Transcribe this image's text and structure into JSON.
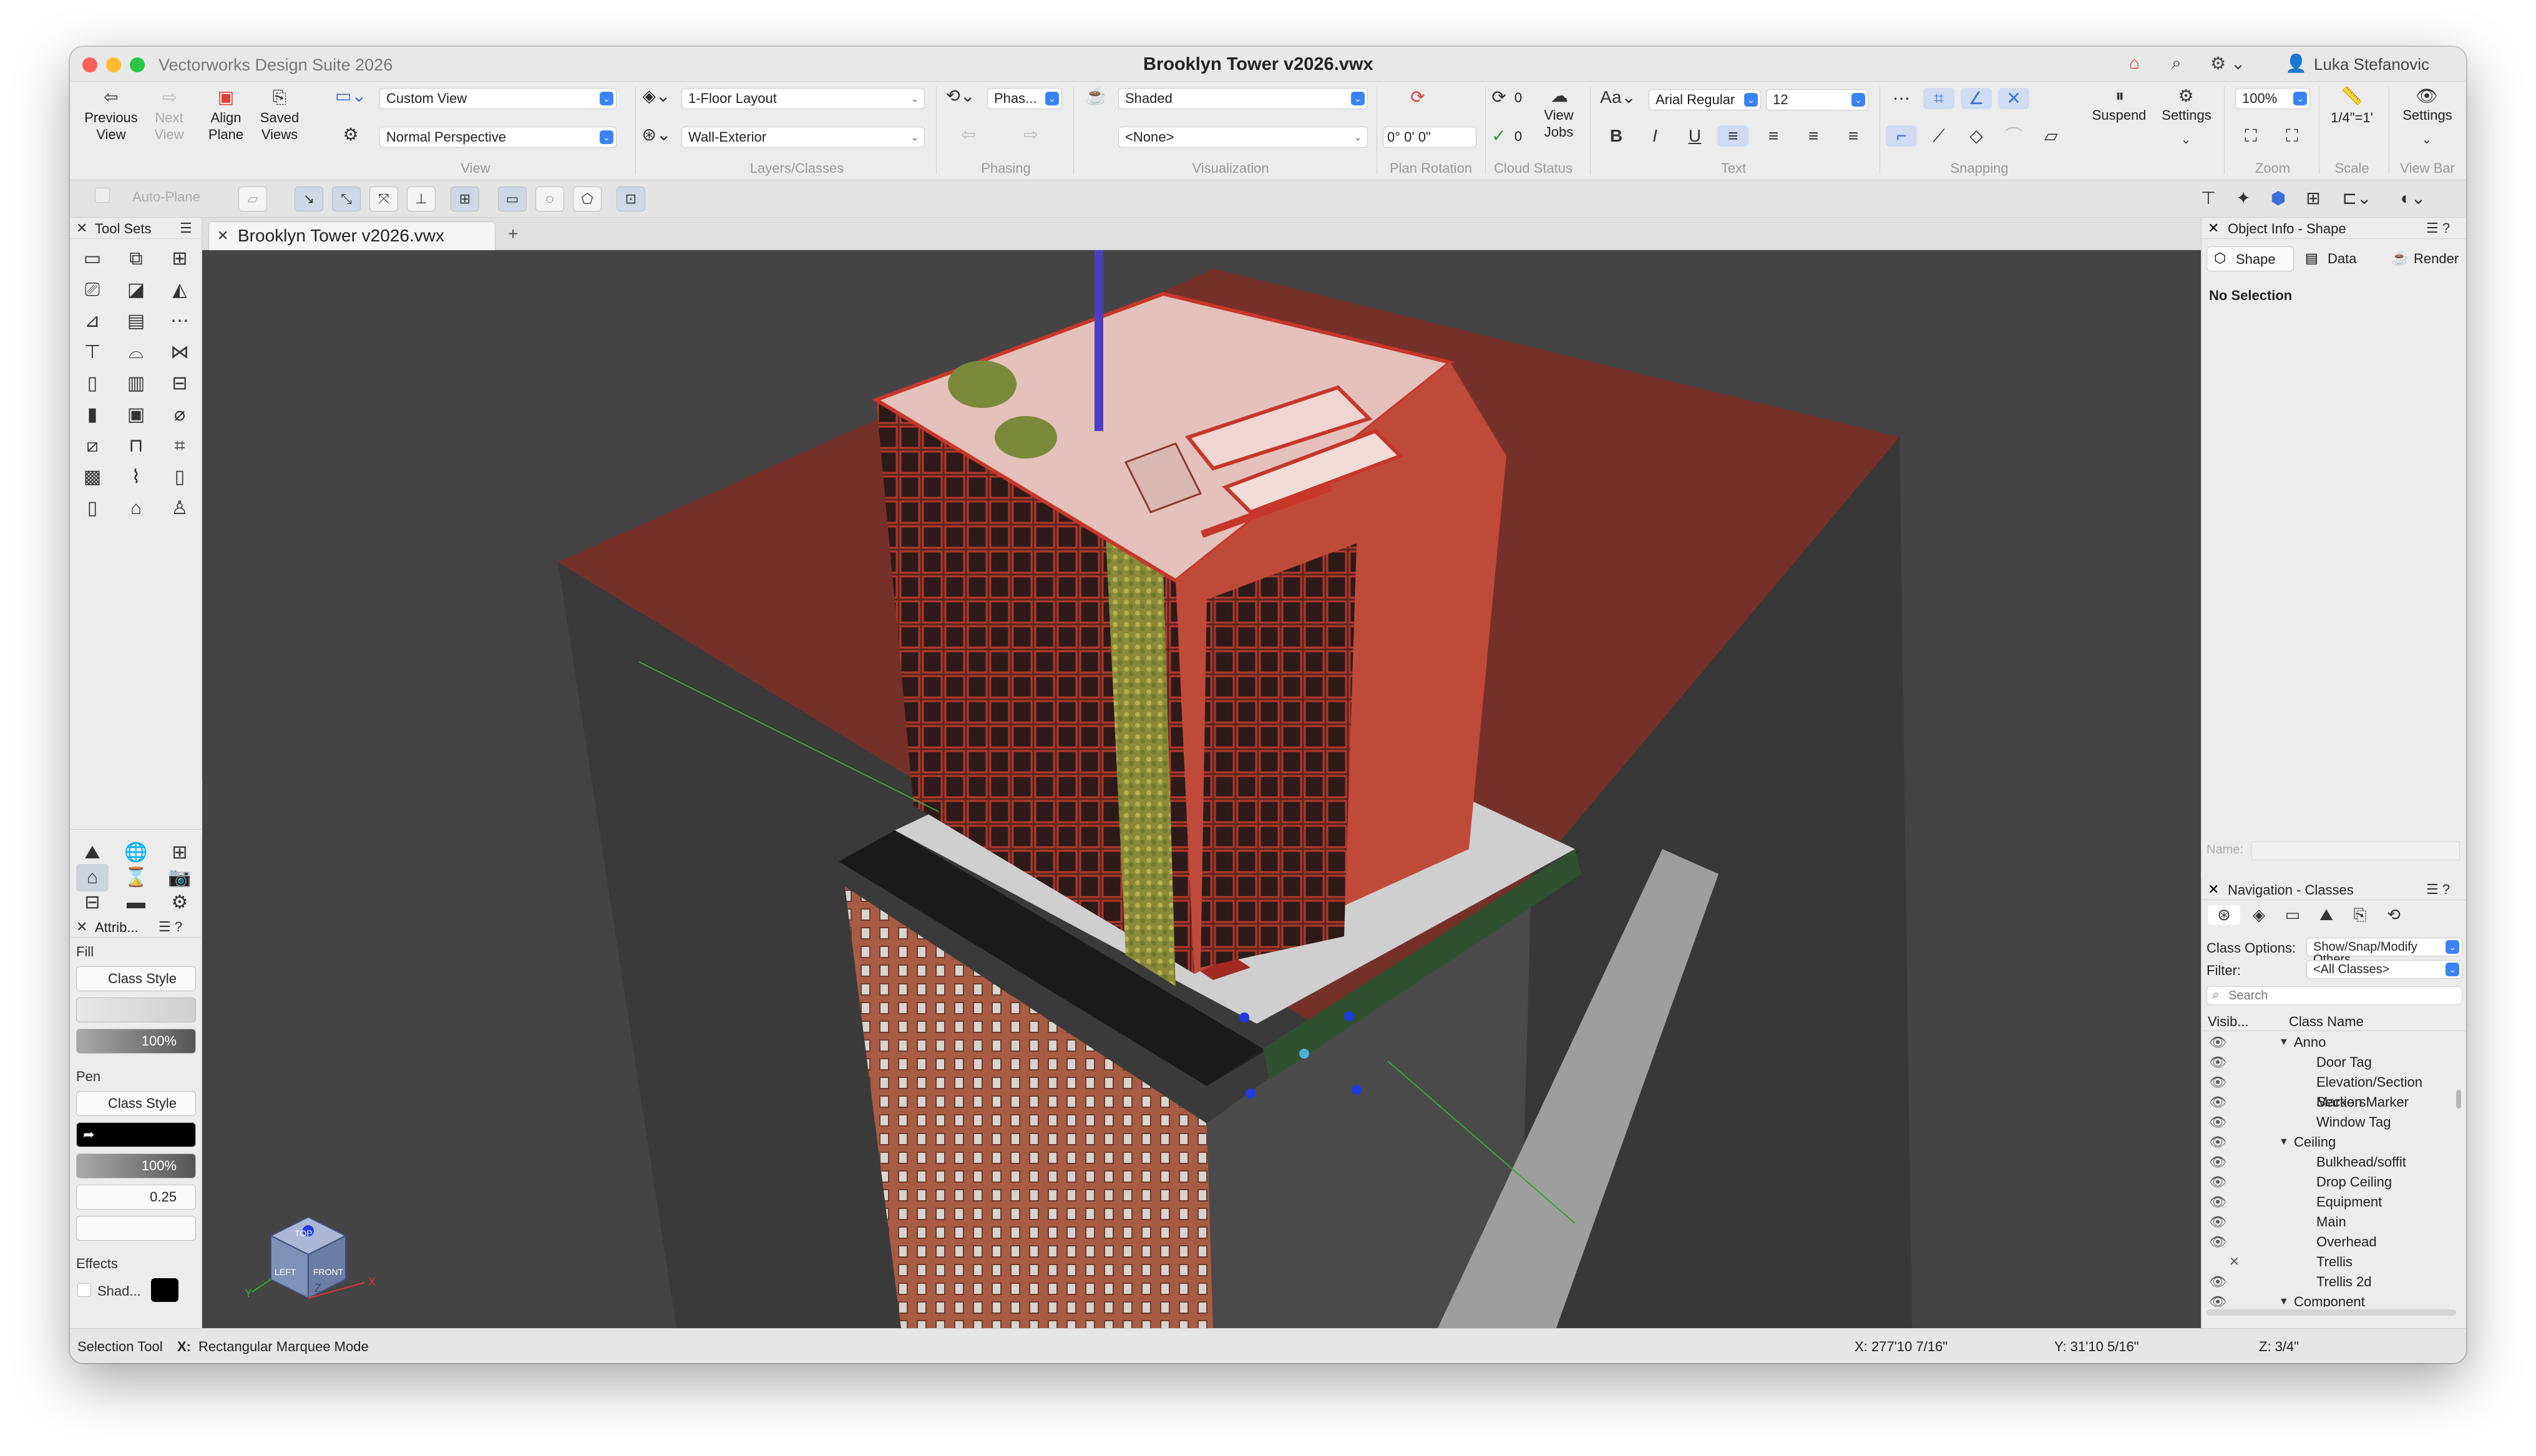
{
  "window": {
    "app_title": "Vectorworks Design Suite 2026",
    "doc_title": "Brooklyn Tower v2026.vwx",
    "user": "Luka Stefanovic"
  },
  "ribbon": {
    "previous_view": "Previous View",
    "next_view": "Next View",
    "align_plane": "Align Plane",
    "saved_views": "Saved Views",
    "view_dropdown": "Custom View",
    "projection_dropdown": "Normal Perspective",
    "view_group": "View",
    "layer_dropdown": "1-Floor Layout",
    "class_dropdown": "Wall-Exterior",
    "layers_group": "Layers/Classes",
    "phasing_dropdown": "Phas...",
    "phasing_group": "Phasing",
    "render_dropdown": "Shaded",
    "viz_dropdown": "<None>",
    "visualization_group": "Visualization",
    "plan_rotation_value": "0° 0' 0\"",
    "plan_rotation_group": "Plan Rotation",
    "cloud_count_a": "0",
    "cloud_count_b": "0",
    "cloud_status_group": "Cloud Status",
    "view_jobs": "View Jobs",
    "font_name": "Arial Regular",
    "font_size": "12",
    "text_group": "Text",
    "snapping_group": "Snapping",
    "suspend": "Suspend",
    "settings": "Settings",
    "zoom_value": "100%",
    "zoom_group": "Zoom",
    "scale_value": "1/4\"=1'",
    "scale_group": "Scale",
    "viewbar_settings": "Settings",
    "viewbar_group": "View Bar"
  },
  "row2": {
    "auto_plane": "Auto-Plane"
  },
  "toolsets": {
    "title": "Tool Sets"
  },
  "attributes": {
    "title": "Attrib...",
    "fill_label": "Fill",
    "fill_style": "Class Style",
    "fill_opacity": "100%",
    "pen_label": "Pen",
    "pen_style": "Class Style",
    "pen_opacity": "100%",
    "pen_weight": "0.25",
    "effects_label": "Effects",
    "shadow": "Shad..."
  },
  "document_tab": {
    "label": "Brooklyn Tower v2026.vwx"
  },
  "view_cube": {
    "face_top": "TOP",
    "face_left": "LEFT",
    "face_front": "FRONT",
    "axis_x": "X",
    "axis_y": "Y",
    "axis_z": "Z"
  },
  "object_info": {
    "title": "Object Info - Shape",
    "tab_shape": "Shape",
    "tab_data": "Data",
    "tab_render": "Render",
    "selection": "No Selection",
    "name_label": "Name:"
  },
  "navigation": {
    "title": "Navigation - Classes",
    "class_options_label": "Class Options:",
    "class_options_value": "Show/Snap/Modify Others",
    "filter_label": "Filter:",
    "filter_value": "<All Classes>",
    "search_placeholder": "Search",
    "col_visibility": "Visib...",
    "col_class_name": "Class Name",
    "rows": [
      {
        "name": "Anno",
        "level": 0,
        "expanded": true,
        "vis": "eye"
      },
      {
        "name": "Door Tag",
        "level": 1,
        "vis": "eye"
      },
      {
        "name": "Elevation/Section Markers",
        "level": 1,
        "vis": "eye"
      },
      {
        "name": "Section Marker",
        "level": 1,
        "vis": "eye"
      },
      {
        "name": "Window Tag",
        "level": 1,
        "vis": "eye"
      },
      {
        "name": "Ceiling",
        "level": 0,
        "expanded": true,
        "vis": "eye"
      },
      {
        "name": "Bulkhead/soffit",
        "level": 1,
        "vis": "eye"
      },
      {
        "name": "Drop Ceiling",
        "level": 1,
        "vis": "eye"
      },
      {
        "name": "Equipment",
        "level": 1,
        "vis": "eye"
      },
      {
        "name": "Main",
        "level": 1,
        "vis": "eye"
      },
      {
        "name": "Overhead",
        "level": 1,
        "vis": "eye"
      },
      {
        "name": "Trellis",
        "level": 1,
        "vis": "x"
      },
      {
        "name": "Trellis 2d",
        "level": 1,
        "vis": "eye"
      },
      {
        "name": "Component",
        "level": 0,
        "expanded": true,
        "vis": "eye"
      }
    ]
  },
  "status": {
    "tool": "Selection Tool",
    "mode_key": "X:",
    "mode": "Rectangular Marquee Mode",
    "x_coord": "X: 277'10 7/16\"",
    "y_coord": "Y: 31'10 5/16\"",
    "z_coord": "Z: 3/4\""
  },
  "colors": {
    "accent": "#3b82f6",
    "viewport_bg": "#444444",
    "building_red": "#c7362b",
    "brick": "#b4654b",
    "floor_pink": "#e7c3bd"
  }
}
